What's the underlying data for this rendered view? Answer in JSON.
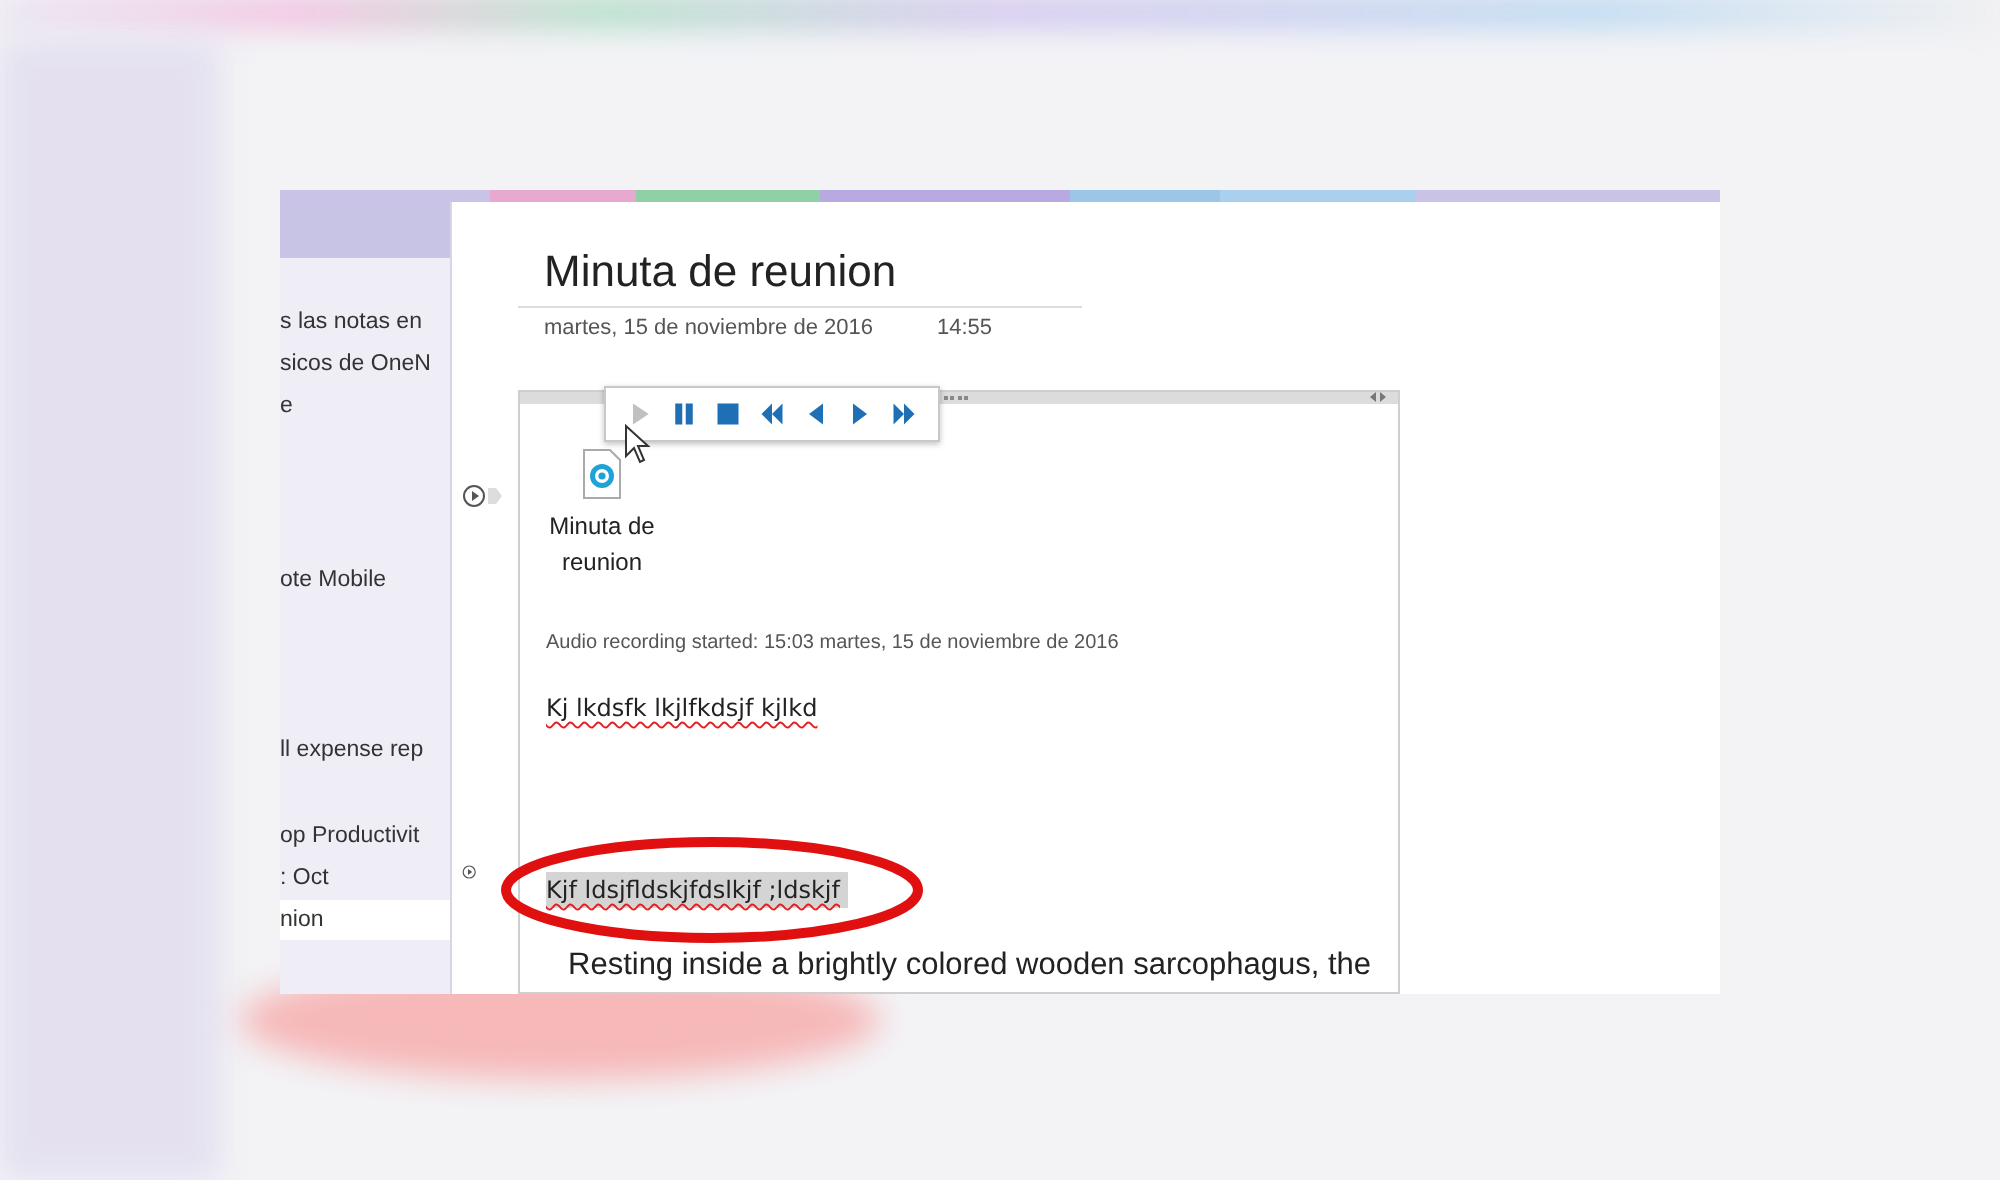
{
  "section_tabs": [
    {
      "color": "#c9c3e8"
    },
    {
      "color": "#e7a9cf"
    },
    {
      "color": "#8fd0a6"
    },
    {
      "color": "#b9a9e3"
    },
    {
      "color": "#9cc6e8"
    },
    {
      "color": "#a9d0ee"
    },
    {
      "color": "#c9c3e8"
    }
  ],
  "sidebar": {
    "items": [
      {
        "label": "s las notas en",
        "selected": false
      },
      {
        "label": "sicos de OneN",
        "selected": false
      },
      {
        "label": "e",
        "selected": false
      },
      {
        "label": "ote Mobile",
        "selected": false
      },
      {
        "label": "ll expense rep",
        "selected": false
      },
      {
        "label": "op Productivit",
        "selected": false
      },
      {
        "label": ": Oct",
        "selected": false
      },
      {
        "label": "nion",
        "selected": true
      }
    ]
  },
  "page": {
    "title": "Minuta de reunion",
    "date": "martes, 15 de noviembre de 2016",
    "time": "14:55",
    "audio_toolbar": [
      {
        "kind": "play",
        "disabled": true
      },
      {
        "kind": "pause",
        "disabled": false
      },
      {
        "kind": "stop",
        "disabled": false
      },
      {
        "kind": "rewind-fast",
        "disabled": false
      },
      {
        "kind": "rewind",
        "disabled": false
      },
      {
        "kind": "forward",
        "disabled": false
      },
      {
        "kind": "forward-fast",
        "disabled": false
      }
    ],
    "attachment": {
      "label": "Minuta de reunion"
    },
    "recording_note": "Audio recording started: 15:03 martes, 15 de noviembre de 2016",
    "paragraphs": [
      {
        "text": "Kj lkdsfk lkjlfkdsjf kjlkd",
        "misspelled": true,
        "highlighted": false,
        "kind": "note"
      },
      {
        "text": "Kjf ldsjfldskjfdslkjf ;ldskjf",
        "misspelled": true,
        "highlighted": true,
        "kind": "note"
      },
      {
        "text": "Resting inside a brightly colored wooden sarcophagus, the",
        "misspelled": false,
        "highlighted": false,
        "kind": "body"
      }
    ]
  }
}
